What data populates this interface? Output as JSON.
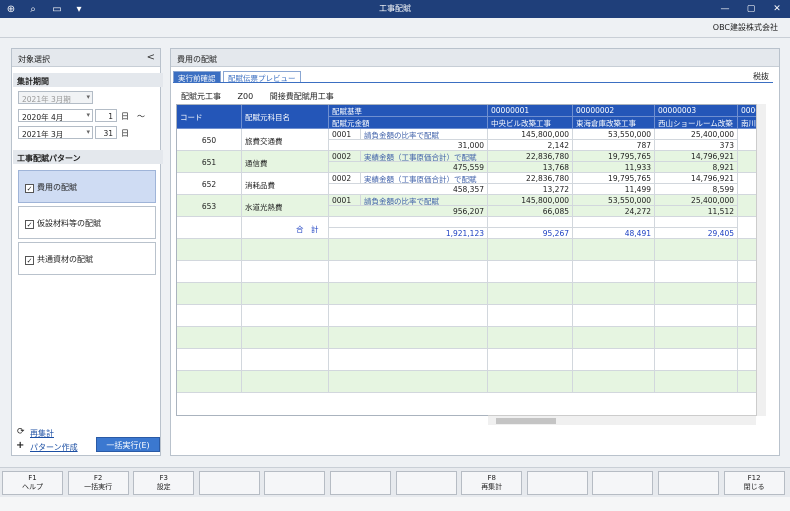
{
  "titlebar": {
    "title": "工事配賦"
  },
  "company": "OBC建設株式会社",
  "left": {
    "header": "対象選択",
    "period_label": "集計期間",
    "period_year_disabled": "2021年  3月期",
    "from_ym": "2020年  4月",
    "from_day": "1",
    "day_unit": "日",
    "range_sep": "～",
    "to_ym": "2021年  3月",
    "to_day": "31",
    "pattern_label": "工事配賦パターン",
    "patterns": [
      "費用の配賦",
      "仮設材料等の配賦",
      "共通資材の配賦"
    ],
    "links": [
      "再集計",
      "パターン作成"
    ],
    "run_all": "一括実行(E)"
  },
  "main": {
    "header": "費用の配賦",
    "tabs": [
      "実行前確認",
      "配賦伝票プレビュー"
    ],
    "tax": "税抜",
    "source": {
      "label": "配賦元工事",
      "code": "Z00",
      "name": "間接費配賦用工事"
    }
  },
  "grid": {
    "headers": {
      "code": "コード",
      "subject": "配賦元科目名",
      "basis": "配賦基準",
      "amount": "配賦元金額"
    },
    "columns": [
      {
        "code": "00000001",
        "name": "中央ビル改築工事"
      },
      {
        "code": "00000002",
        "name": "東海倉庫改築工事"
      },
      {
        "code": "00000003",
        "name": "西山ショールーム改築"
      },
      {
        "code": "0000",
        "name": "南川"
      }
    ],
    "rows": [
      {
        "code": "650",
        "subject": "旅費交通費",
        "basis_no": "0001",
        "basis": "請負金額の比率で配賦",
        "amount": "31,000",
        "v1": [
          "145,800,000",
          "2,142"
        ],
        "v2": [
          "53,550,000",
          "787"
        ],
        "v3": [
          "25,400,000",
          "373"
        ]
      },
      {
        "code": "651",
        "subject": "通信費",
        "basis_no": "0002",
        "basis": "実績金額（工事原価合計）で配賦",
        "amount": "475,559",
        "v1": [
          "22,836,780",
          "13,768"
        ],
        "v2": [
          "19,795,765",
          "11,933"
        ],
        "v3": [
          "14,796,921",
          "8,921"
        ]
      },
      {
        "code": "652",
        "subject": "消耗品費",
        "basis_no": "0002",
        "basis": "実績金額（工事原価合計）で配賦",
        "amount": "458,357",
        "v1": [
          "22,836,780",
          "13,272"
        ],
        "v2": [
          "19,795,765",
          "11,499"
        ],
        "v3": [
          "14,796,921",
          "8,599"
        ]
      },
      {
        "code": "653",
        "subject": "水道光熱費",
        "basis_no": "0001",
        "basis": "請負金額の比率で配賦",
        "amount": "956,207",
        "v1": [
          "145,800,000",
          "66,085"
        ],
        "v2": [
          "53,550,000",
          "24,272"
        ],
        "v3": [
          "25,400,000",
          "11,512"
        ]
      }
    ],
    "total": {
      "label": "合　計",
      "amount": "1,921,123",
      "v1": "95,267",
      "v2": "48,491",
      "v3": "29,405"
    }
  },
  "fkeys": [
    {
      "key": "F1",
      "label": "ヘルプ"
    },
    {
      "key": "F2",
      "label": "一括実行"
    },
    {
      "key": "F3",
      "label": "設定"
    },
    {
      "key": "",
      "label": ""
    },
    {
      "key": "",
      "label": ""
    },
    {
      "key": "",
      "label": ""
    },
    {
      "key": "",
      "label": ""
    },
    {
      "key": "F8",
      "label": "再集計"
    },
    {
      "key": "",
      "label": ""
    },
    {
      "key": "",
      "label": ""
    },
    {
      "key": "",
      "label": ""
    },
    {
      "key": "F12",
      "label": "閉じる"
    }
  ]
}
